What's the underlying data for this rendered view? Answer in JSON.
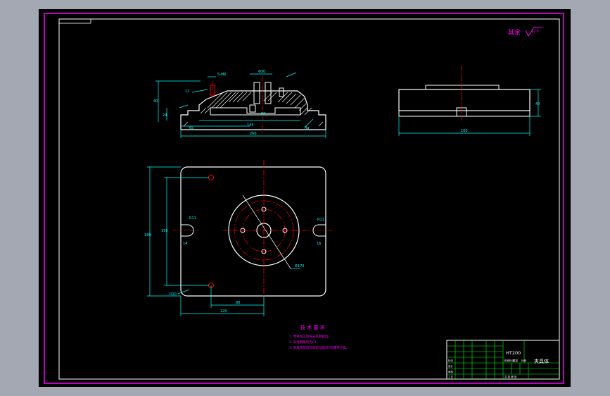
{
  "drawing": {
    "roughness_note": "其余",
    "roughness_value": "12.5",
    "tech_requirements": {
      "title": "技 术 要 求",
      "items": [
        "1. 零件加工后除去毛刺锐边。",
        "2. 未注倒角均为C1。",
        "3. 夹具装配后检验定位面对T形槽平行度。"
      ]
    },
    "title_block": {
      "material": "HT200",
      "drawing_name": "夹具体",
      "row_labels": [
        "标记",
        "设计",
        "审核",
        "工艺"
      ],
      "scale_labels": [
        "阶段标记",
        "重量",
        "比例"
      ],
      "sheet_label": "共 张 第 张"
    },
    "dims": {
      "front_top_small": "5-M6",
      "front_top_mid": "Φ30",
      "front_left": "40",
      "front_left2": "24",
      "front_left3": "12",
      "front_bottom1": "65",
      "front_bottom2": "145",
      "front_bottom_total": "260",
      "front_inner": "80",
      "front_ra": "Ra",
      "side_height": "40",
      "side_width": "160",
      "plan_height": "180",
      "plan_height_inner": "150",
      "plan_slot_left": "R11",
      "plan_slot_right": "R11",
      "plan_slot_w": "14",
      "plan_hole_w": "16",
      "plan_circle": "Φ170",
      "plan_bottom_mid": "80",
      "plan_bottom_left": "120",
      "plan_corner": "R10"
    }
  }
}
